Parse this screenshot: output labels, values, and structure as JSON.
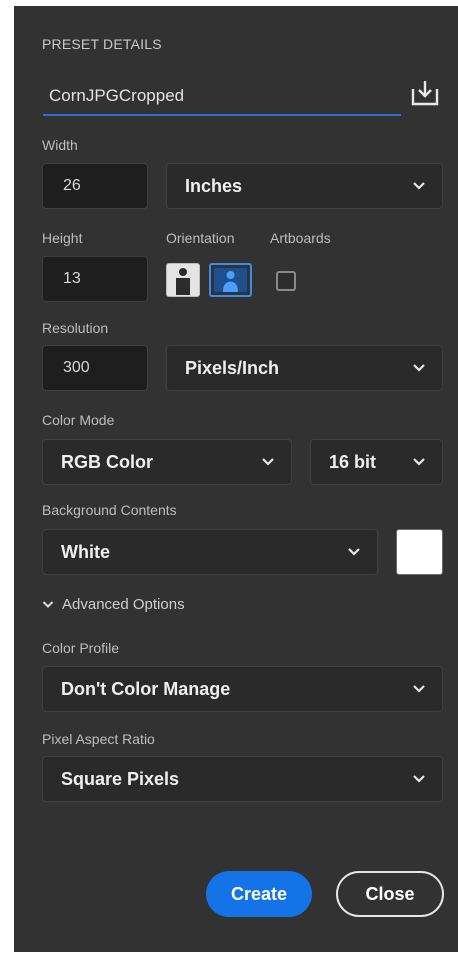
{
  "preset": {
    "section_title": "PRESET DETAILS",
    "name_value": "CornJPGCropped",
    "save_icon": "save-preset-icon"
  },
  "width": {
    "label": "Width",
    "value": "26",
    "unit": "Inches"
  },
  "height": {
    "label": "Height",
    "value": "13"
  },
  "orientation": {
    "label": "Orientation",
    "selected": "landscape",
    "portrait_icon": "portrait-orientation-icon",
    "landscape_icon": "landscape-orientation-icon"
  },
  "artboards": {
    "label": "Artboards",
    "checked": false
  },
  "resolution": {
    "label": "Resolution",
    "value": "300",
    "unit": "Pixels/Inch"
  },
  "color_mode": {
    "label": "Color Mode",
    "mode": "RGB Color",
    "bit_depth": "16 bit"
  },
  "background": {
    "label": "Background Contents",
    "value": "White",
    "swatch_color": "#ffffff"
  },
  "advanced": {
    "label": "Advanced Options",
    "expanded": true
  },
  "color_profile": {
    "label": "Color Profile",
    "value": "Don't Color Manage"
  },
  "pixel_aspect": {
    "label": "Pixel Aspect Ratio",
    "value": "Square Pixels"
  },
  "actions": {
    "create_label": "Create",
    "close_label": "Close"
  },
  "colors": {
    "panel_bg": "#323232",
    "accent_blue": "#1473e6",
    "field_bg": "#1e1e1e"
  }
}
